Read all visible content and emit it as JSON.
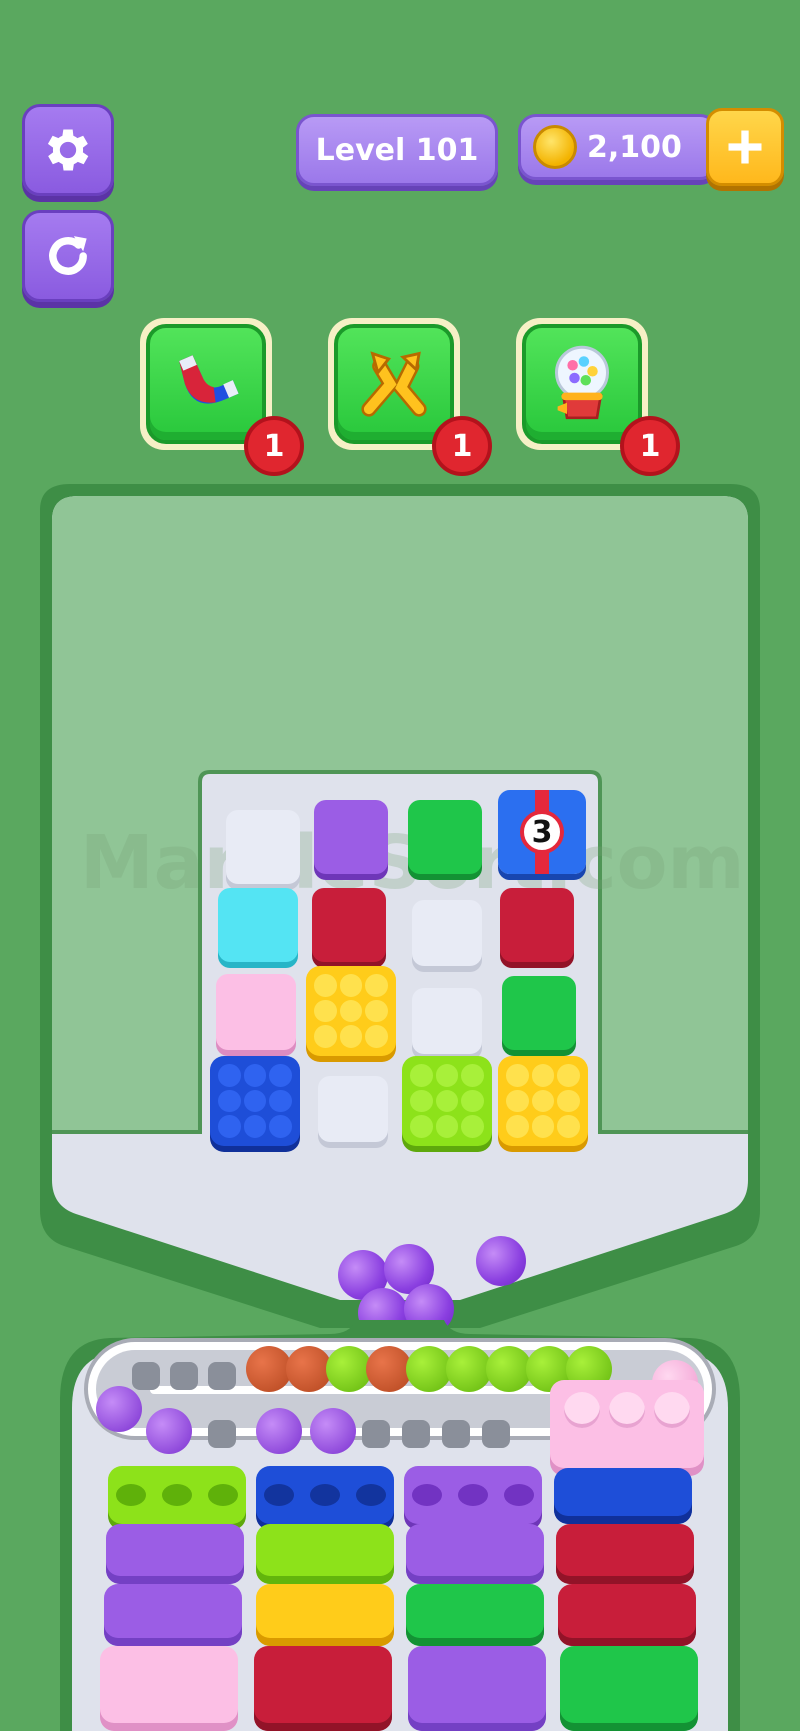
{
  "hud": {
    "level_label": "Level 101",
    "coins": "2,100"
  },
  "boosters": [
    {
      "name": "magnet",
      "count": "1"
    },
    {
      "name": "shuffle",
      "count": "1"
    },
    {
      "name": "gumball-machine",
      "count": "1"
    }
  ],
  "board": {
    "watermark": "MarbleSort.com",
    "mystery_box_count": "3"
  },
  "colors": {
    "background": "#5aa85f",
    "purple": "#9b5de5",
    "green": "#1fc64a",
    "red": "#c81e3a",
    "cyan": "#54e4f3",
    "pink": "#fcbfe5",
    "yellow": "#ffcc1a",
    "blue": "#1e4ed8",
    "lime": "#8de21a",
    "white_slot": "#e6e9f3"
  }
}
